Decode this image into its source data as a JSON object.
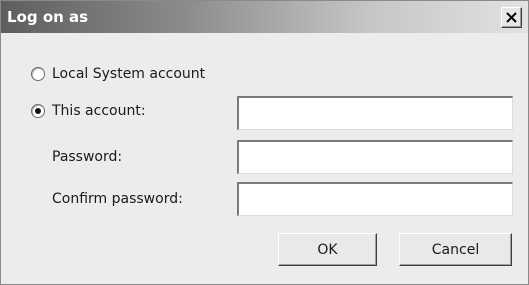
{
  "window": {
    "title": "Log on as",
    "close_icon": "close-icon"
  },
  "account": {
    "local_system_label": "Local System account",
    "local_system_selected": false,
    "this_account_label": "This account:",
    "this_account_selected": true,
    "this_account_value": ""
  },
  "password": {
    "label": "Password:",
    "value": ""
  },
  "confirm_password": {
    "label": "Confirm password:",
    "value": ""
  },
  "buttons": {
    "ok_label": "OK",
    "cancel_label": "Cancel"
  }
}
